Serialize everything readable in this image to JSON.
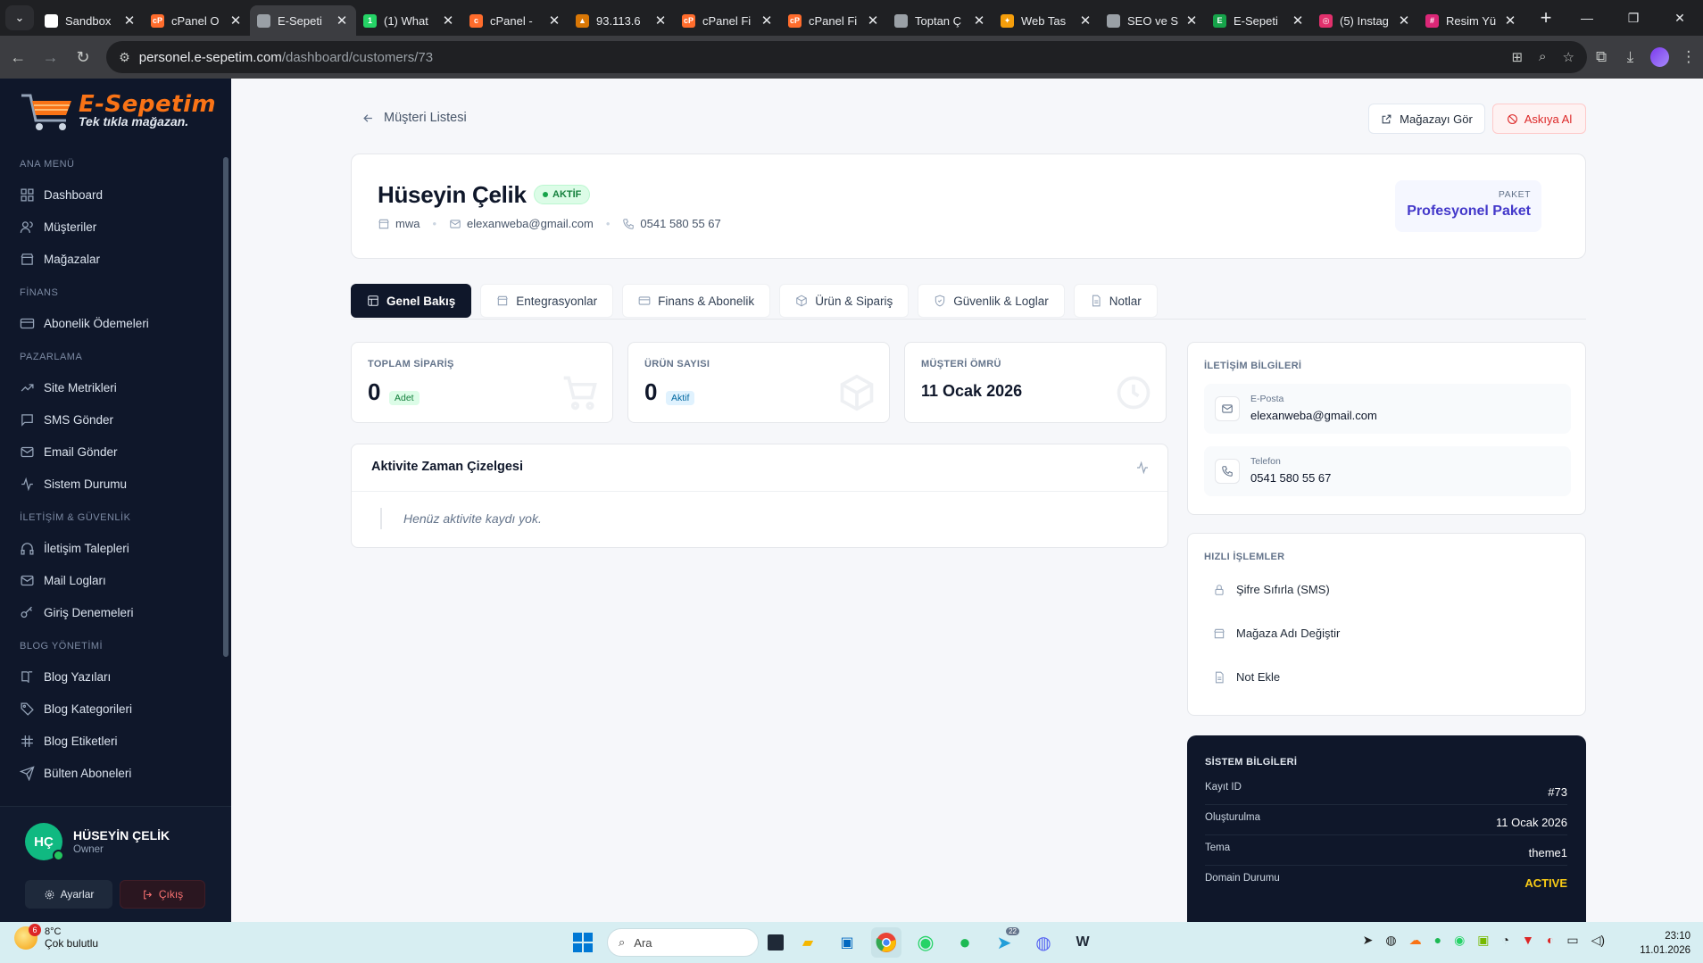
{
  "browser": {
    "tabs": [
      {
        "title": "Sandbox",
        "favicon_color": "#ffffff",
        "favicon_text": ""
      },
      {
        "title": "cPanel O",
        "favicon_color": "#ff6c2c",
        "favicon_text": "cP"
      },
      {
        "title": "E-Sepeti",
        "favicon_color": "#9aa0a6",
        "favicon_text": "",
        "active": true
      },
      {
        "title": "(1) What",
        "favicon_color": "#25d366",
        "favicon_text": "1"
      },
      {
        "title": "cPanel - ",
        "favicon_color": "#ff6c2c",
        "favicon_text": "c"
      },
      {
        "title": "93.113.6",
        "favicon_color": "#d97706",
        "favicon_text": "▲"
      },
      {
        "title": "cPanel Fi",
        "favicon_color": "#ff6c2c",
        "favicon_text": "cP"
      },
      {
        "title": "cPanel Fi",
        "favicon_color": "#ff6c2c",
        "favicon_text": "cP"
      },
      {
        "title": "Toptan Ç",
        "favicon_color": "#9aa0a6",
        "favicon_text": ""
      },
      {
        "title": "Web Tas",
        "favicon_color": "#f59e0b",
        "favicon_text": "✦"
      },
      {
        "title": "SEO ve S",
        "favicon_color": "#9aa0a6",
        "favicon_text": ""
      },
      {
        "title": "E-Sepeti",
        "favicon_color": "#16a34a",
        "favicon_text": "E"
      },
      {
        "title": "(5) Instag",
        "favicon_color": "#e1306c",
        "favicon_text": "◎"
      },
      {
        "title": "Resim Yü",
        "favicon_color": "#db2777",
        "favicon_text": "#"
      }
    ],
    "url_host": "personel.e-sepetim.com",
    "url_path": "/dashboard/customers/73"
  },
  "sidebar": {
    "brand_name": "E-Sepetim",
    "brand_tagline": "Tek tıkla mağazan.",
    "sections": [
      {
        "title": "ANA MENÜ",
        "items": [
          {
            "label": "Dashboard",
            "icon": "grid-icon"
          },
          {
            "label": "Müşteriler",
            "icon": "users-icon"
          },
          {
            "label": "Mağazalar",
            "icon": "store-icon"
          }
        ]
      },
      {
        "title": "FİNANS",
        "items": [
          {
            "label": "Abonelik Ödemeleri",
            "icon": "credit-card-icon"
          }
        ]
      },
      {
        "title": "PAZARLAMA",
        "items": [
          {
            "label": "Site Metrikleri",
            "icon": "trending-up-icon"
          },
          {
            "label": "SMS Gönder",
            "icon": "message-square-icon"
          },
          {
            "label": "Email Gönder",
            "icon": "mail-icon"
          },
          {
            "label": "Sistem Durumu",
            "icon": "activity-icon"
          }
        ]
      },
      {
        "title": "İLETİŞİM & GÜVENLİK",
        "items": [
          {
            "label": "İletişim Talepleri",
            "icon": "headphones-icon"
          },
          {
            "label": "Mail Logları",
            "icon": "mail-icon"
          },
          {
            "label": "Giriş Denemeleri",
            "icon": "key-icon"
          }
        ]
      },
      {
        "title": "BLOG YÖNETİMİ",
        "items": [
          {
            "label": "Blog Yazıları",
            "icon": "book-icon"
          },
          {
            "label": "Blog Kategorileri",
            "icon": "tag-icon"
          },
          {
            "label": "Blog Etiketleri",
            "icon": "hash-icon"
          },
          {
            "label": "Bülten Aboneleri",
            "icon": "send-icon"
          }
        ]
      }
    ],
    "user": {
      "initials": "HÇ",
      "name": "HÜSEYİN ÇELİK",
      "role": "Owner",
      "settings_label": "Ayarlar",
      "logout_label": "Çıkış"
    }
  },
  "main": {
    "back_label": "Müşteri Listesi",
    "store_button": "Mağazayı Gör",
    "suspend_button": "Askıya Al",
    "customer": {
      "name": "Hüseyin Çelik",
      "status": "AKTİF",
      "store": "mwa",
      "email": "elexanweba@gmail.com",
      "phone": "0541 580 55 67",
      "package_label": "PAKET",
      "package_name": "Profesyonel Paket"
    },
    "tabs": [
      {
        "label": "Genel Bakış",
        "icon": "layout-icon",
        "active": true
      },
      {
        "label": "Entegrasyonlar",
        "icon": "store-icon"
      },
      {
        "label": "Finans & Abonelik",
        "icon": "credit-card-icon"
      },
      {
        "label": "Ürün & Sipariş",
        "icon": "box-icon"
      },
      {
        "label": "Güvenlik & Loglar",
        "icon": "shield-icon"
      },
      {
        "label": "Notlar",
        "icon": "file-icon"
      }
    ],
    "stats": {
      "orders": {
        "label": "TOPLAM SİPARİŞ",
        "value": "0",
        "chip": "Adet"
      },
      "products": {
        "label": "ÜRÜN SAYISI",
        "value": "0",
        "chip": "Aktif"
      },
      "lifetime": {
        "label": "MÜŞTERİ ÖMRÜ",
        "value": "11 Ocak 2026"
      }
    },
    "activity": {
      "title": "Aktivite Zaman Çizelgesi",
      "empty": "Henüz aktivite kaydı yok."
    },
    "contact": {
      "title": "İLETİŞİM BİLGİLERİ",
      "email_label": "E-Posta",
      "email": "elexanweba@gmail.com",
      "phone_label": "Telefon",
      "phone": "0541 580 55 67"
    },
    "quick": {
      "title": "HIZLI İŞLEMLER",
      "items": [
        "Şifre Sıfırla (SMS)",
        "Mağaza Adı Değiştir",
        "Not Ekle"
      ]
    },
    "system": {
      "title": "SİSTEM BİLGİLERİ",
      "rows": [
        {
          "key": "Kayıt ID",
          "value": "#73"
        },
        {
          "key": "Oluşturulma",
          "value": "11 Ocak 2026"
        },
        {
          "key": "Tema",
          "value": "theme1"
        },
        {
          "key": "Domain Durumu",
          "value": "ACTIVE"
        }
      ],
      "active_color": "#facc15"
    }
  },
  "taskbar": {
    "weather_badge": "6",
    "weather_temp": "8°C",
    "weather_desc": "Çok bulutlu",
    "search_placeholder": "Ara",
    "telegram_badge": "22",
    "time": "23:10",
    "date": "11.01.2026"
  }
}
